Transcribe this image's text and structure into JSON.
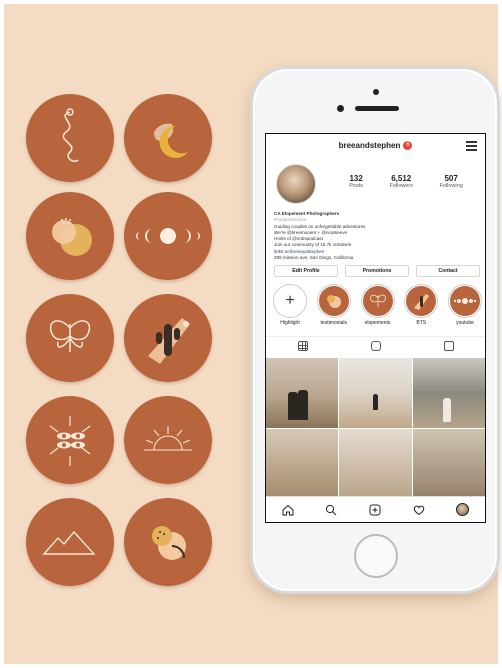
{
  "profile": {
    "username": "breeandstephen",
    "notifications": "6",
    "posts": "132",
    "posts_label": "Posts",
    "followers": "6,512",
    "followers_label": "Followers",
    "following": "507",
    "following_label": "Following",
    "bio_name": "CA Elopement Photographers",
    "bio_category": "Product/Service",
    "bio_line1": "Guiding couples on unforgettable adventures",
    "bio_line2": "We're @breemooers + @ecatseeve",
    "bio_line3": "Hosts of @nobspodcast",
    "bio_line4": "Join our community of 15.7k creatives",
    "bio_link": "linktr.ee/breeandstephen",
    "bio_address": "285 mission ave, San Diego, California"
  },
  "actions": {
    "edit_profile": "Edit Profile",
    "promotions": "Promotions",
    "contact": "Contact"
  },
  "highlights": [
    {
      "label": "Highlight"
    },
    {
      "label": "testimonials"
    },
    {
      "label": "elopements"
    },
    {
      "label": "BTS"
    },
    {
      "label": "youtube"
    }
  ],
  "colors": {
    "background": "#f4dcc4",
    "cover": "#b8643c",
    "accent": "#f3c9a0"
  },
  "icons": [
    "home-icon",
    "search-icon",
    "add-post-icon",
    "heart-icon",
    "profile-avatar",
    "grid-icon",
    "igtv-icon",
    "tagged-icon",
    "menu-icon"
  ]
}
